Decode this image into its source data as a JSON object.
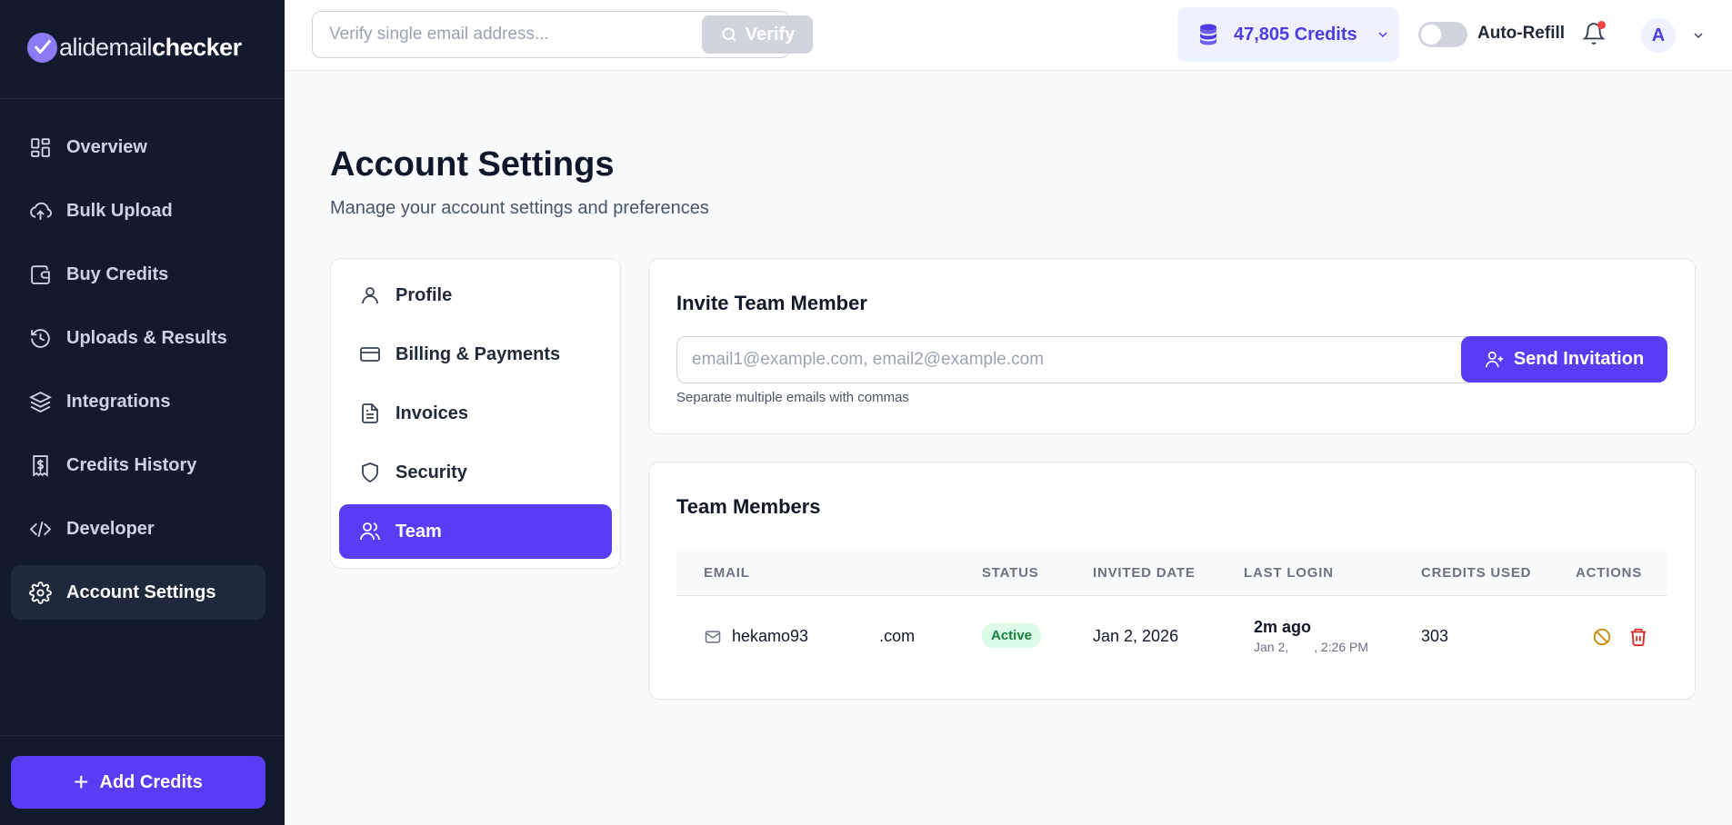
{
  "brand": {
    "logo_v": "V",
    "logo_text_light": "alidemail",
    "logo_text_bold": "checker"
  },
  "sidebar": {
    "items": [
      {
        "label": "Overview",
        "icon": "grid-icon"
      },
      {
        "label": "Bulk Upload",
        "icon": "cloud-upload-icon"
      },
      {
        "label": "Buy Credits",
        "icon": "wallet-icon"
      },
      {
        "label": "Uploads & Results",
        "icon": "history-icon"
      },
      {
        "label": "Integrations",
        "icon": "layers-icon"
      },
      {
        "label": "Credits History",
        "icon": "receipt-dollar-icon"
      },
      {
        "label": "Developer",
        "icon": "code-icon"
      },
      {
        "label": "Account Settings",
        "icon": "gear-icon",
        "active": true
      }
    ],
    "add_credits_label": "Add Credits"
  },
  "topbar": {
    "verify_placeholder": "Verify single email address...",
    "verify_label": "Verify",
    "credits_label": "47,805 Credits",
    "auto_refill_label": "Auto-Refill",
    "auto_refill_on": false,
    "avatar_initial": "A"
  },
  "page": {
    "title": "Account Settings",
    "subtitle": "Manage your account settings and preferences"
  },
  "settings_nav": [
    {
      "label": "Profile",
      "icon": "user-icon"
    },
    {
      "label": "Billing & Payments",
      "icon": "credit-card-icon"
    },
    {
      "label": "Invoices",
      "icon": "document-icon"
    },
    {
      "label": "Security",
      "icon": "shield-icon"
    },
    {
      "label": "Team",
      "icon": "users-icon",
      "active": true
    }
  ],
  "invite": {
    "title": "Invite Team Member",
    "placeholder": "email1@example.com, email2@example.com",
    "button_label": "Send Invitation",
    "hint": "Separate multiple emails with commas"
  },
  "team": {
    "title": "Team Members",
    "columns": [
      "EMAIL",
      "STATUS",
      "INVITED DATE",
      "LAST LOGIN",
      "CREDITS USED",
      "ACTIONS"
    ],
    "rows": [
      {
        "email": "hekamo93",
        "email_domain": ".com",
        "status": "Active",
        "invited_date": "Jan 2, 2026",
        "last_login": "2m ago",
        "last_login_detail_a": "Jan 2,",
        "last_login_detail_b": ", 2:26 PM",
        "credits_used": "303"
      }
    ]
  },
  "colors": {
    "accent": "#5b3cf5",
    "sidebar_bg": "#121a2e",
    "success": "#15803d",
    "danger": "#dc2626",
    "warning": "#ca8a04"
  }
}
